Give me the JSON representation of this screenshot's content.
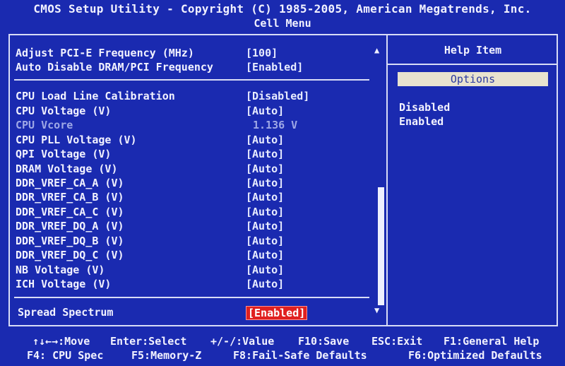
{
  "header": {
    "title": "CMOS Setup Utility - Copyright (C) 1985-2005, American Megatrends, Inc.",
    "menu": "Cell Menu"
  },
  "settings": {
    "group1": [
      {
        "label": "Adjust PCI-E Frequency (MHz)",
        "value": "[100]"
      },
      {
        "label": "Auto Disable DRAM/PCI Frequency",
        "value": "[Enabled]"
      }
    ],
    "group2": [
      {
        "label": "CPU Load Line Calibration",
        "value": "[Disabled]"
      },
      {
        "label": "CPU Voltage (V)",
        "value": "[Auto]"
      },
      {
        "label": "CPU Vcore",
        "value": "1.136 V"
      },
      {
        "label": "CPU PLL Voltage (V)",
        "value": "[Auto]"
      },
      {
        "label": "QPI Voltage (V)",
        "value": "[Auto]"
      },
      {
        "label": "DRAM Voltage (V)",
        "value": "[Auto]"
      },
      {
        "label": "DDR_VREF_CA_A (V)",
        "value": "[Auto]"
      },
      {
        "label": "DDR_VREF_CA_B (V)",
        "value": "[Auto]"
      },
      {
        "label": "DDR_VREF_CA_C (V)",
        "value": "[Auto]"
      },
      {
        "label": "DDR_VREF_DQ_A (V)",
        "value": "[Auto]"
      },
      {
        "label": "DDR_VREF_DQ_B (V)",
        "value": "[Auto]"
      },
      {
        "label": "DDR_VREF_DQ_C (V)",
        "value": "[Auto]"
      },
      {
        "label": "NB Voltage (V)",
        "value": "[Auto]"
      },
      {
        "label": "ICH Voltage (V)",
        "value": "[Auto]"
      }
    ],
    "group3": [
      {
        "label": "Spread Spectrum",
        "value": "[Enabled]"
      }
    ]
  },
  "help": {
    "title": "Help Item",
    "options_label": "Options",
    "options": [
      "Disabled",
      "Enabled"
    ]
  },
  "footer": {
    "line1": [
      "↑↓←→:Move",
      "Enter:Select",
      "+/-/:Value",
      "F10:Save",
      "ESC:Exit",
      "F1:General Help"
    ],
    "line2": [
      "F4: CPU Spec",
      "F5:Memory-Z",
      "F8:Fail-Safe Defaults",
      "F6:Optimized Defaults"
    ]
  },
  "scroll": {
    "arrow_up": "▲",
    "arrow_down": "▼"
  },
  "colors": {
    "background": "#1a2ab0",
    "highlight": "#e02020",
    "options_box": "#e8e3cf"
  }
}
